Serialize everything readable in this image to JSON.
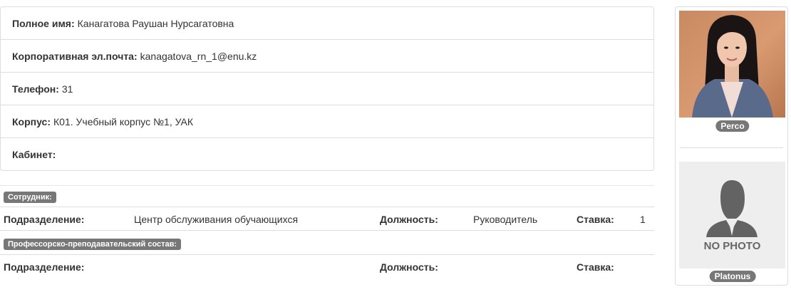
{
  "profile": {
    "full_name_label": "Полное имя:",
    "full_name": "Канагатова Раушан Нурсагатовна",
    "email_label": "Корпоративная эл.почта:",
    "email": "kanagatova_rn_1@enu.kz",
    "phone_label": "Телефон:",
    "phone": "31",
    "building_label": "Корпус:",
    "building": "К01. Учебный корпус №1, УАК",
    "office_label": "Кабинет:",
    "office": ""
  },
  "employee": {
    "badge": "Сотрудник:",
    "department_label": "Подразделение:",
    "department": "Центр обслуживания обучающихся",
    "position_label": "Должность:",
    "position": "Руководитель",
    "rate_label": "Ставка:",
    "rate": "1"
  },
  "faculty": {
    "badge": "Профессорско-преподавательский состав:",
    "department_label": "Подразделение:",
    "department": "",
    "position_label": "Должность:",
    "position": "",
    "rate_label": "Ставка:",
    "rate": ""
  },
  "photos": {
    "perco_label": "Perco",
    "placeholder_text": "NO PHOTO",
    "platonus_label": "Platonus"
  },
  "colors": {
    "badge_bg": "#777777",
    "border": "#dddddd"
  }
}
